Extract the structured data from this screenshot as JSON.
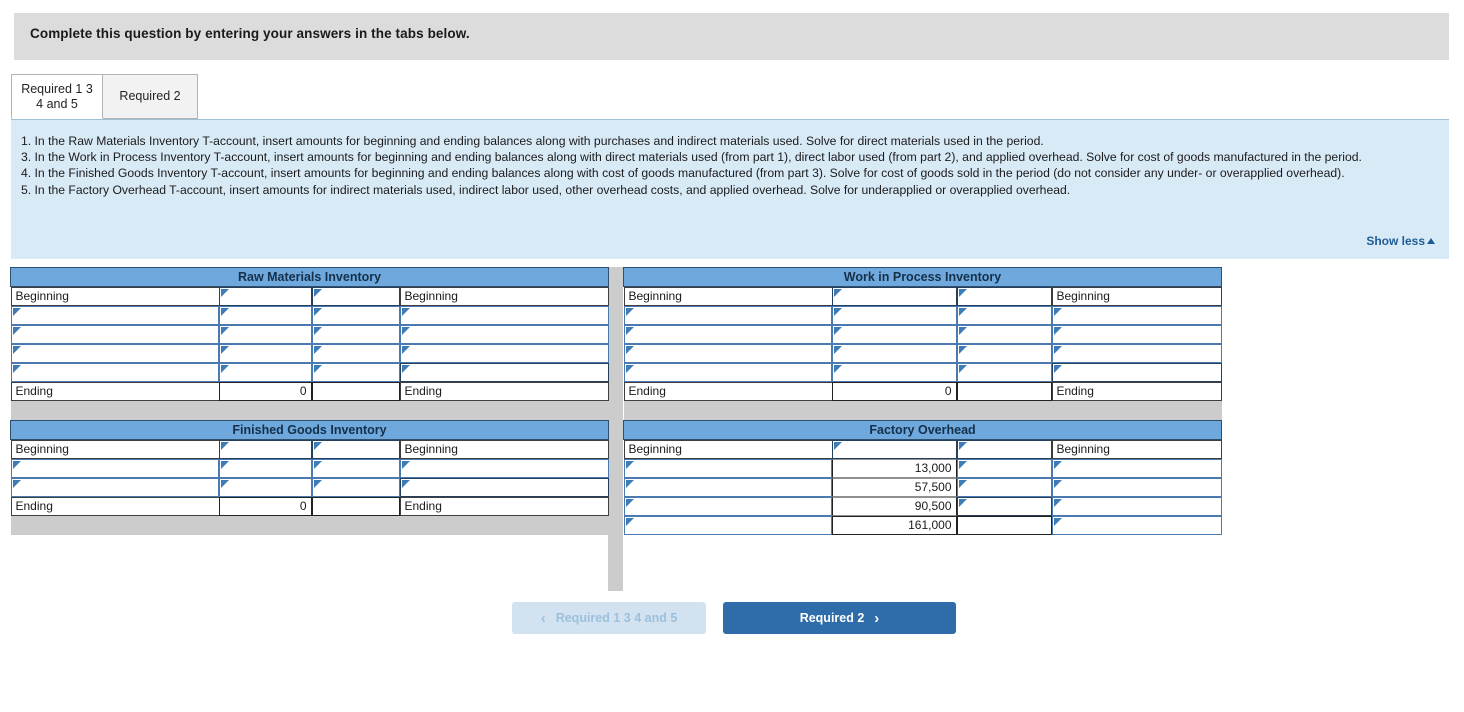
{
  "banner": {
    "text": "Complete this question by entering your answers in the tabs below."
  },
  "tabs": [
    {
      "label": "Required 1 3 4 and 5",
      "active": true
    },
    {
      "label": "Required 2",
      "active": false
    }
  ],
  "instructions": {
    "lines": [
      "1. In the Raw Materials Inventory T-account, insert amounts for beginning and ending balances along with purchases and indirect materials used. Solve for direct materials used in the period.",
      "3. In the Work in Process Inventory T-account, insert amounts for beginning and ending balances along with direct materials used (from part 1), direct labor used (from part 2), and applied overhead. Solve for cost of goods manufactured in the period.",
      "4. In the Finished Goods Inventory T-account, insert amounts for beginning and ending balances along with cost of goods manufactured (from part 3). Solve for cost of goods sold in the period (do not consider any under- or overapplied overhead).",
      "5. In the Factory Overhead T-account, insert amounts for indirect materials used, indirect labor used, other overhead costs, and applied overhead. Solve for underapplied or overapplied overhead."
    ],
    "show_less_label": "Show less"
  },
  "accounts": {
    "raw_materials": {
      "title": "Raw Materials Inventory",
      "rows": [
        {
          "left_label": "Beginning",
          "debit": "",
          "credit": "",
          "right_label": "Beginning"
        },
        {
          "left_label": "",
          "debit": "",
          "credit": "",
          "right_label": ""
        },
        {
          "left_label": "",
          "debit": "",
          "credit": "",
          "right_label": ""
        },
        {
          "left_label": "",
          "debit": "",
          "credit": "",
          "right_label": ""
        },
        {
          "left_label": "",
          "debit": "",
          "credit": "",
          "right_label": ""
        },
        {
          "left_label": "Ending",
          "debit": "0",
          "credit": "",
          "right_label": "Ending"
        }
      ]
    },
    "work_in_process": {
      "title": "Work in Process Inventory",
      "rows": [
        {
          "left_label": "Beginning",
          "debit": "",
          "credit": "",
          "right_label": "Beginning"
        },
        {
          "left_label": "",
          "debit": "",
          "credit": "",
          "right_label": ""
        },
        {
          "left_label": "",
          "debit": "",
          "credit": "",
          "right_label": ""
        },
        {
          "left_label": "",
          "debit": "",
          "credit": "",
          "right_label": ""
        },
        {
          "left_label": "",
          "debit": "",
          "credit": "",
          "right_label": ""
        },
        {
          "left_label": "Ending",
          "debit": "0",
          "credit": "",
          "right_label": "Ending"
        }
      ]
    },
    "finished_goods": {
      "title": "Finished Goods Inventory",
      "rows": [
        {
          "left_label": "Beginning",
          "debit": "",
          "credit": "",
          "right_label": "Beginning"
        },
        {
          "left_label": "",
          "debit": "",
          "credit": "",
          "right_label": ""
        },
        {
          "left_label": "",
          "debit": "",
          "credit": "",
          "right_label": ""
        },
        {
          "left_label": "Ending",
          "debit": "0",
          "credit": "",
          "right_label": "Ending"
        }
      ]
    },
    "factory_overhead": {
      "title": "Factory Overhead",
      "rows": [
        {
          "left_label": "Beginning",
          "debit": "",
          "credit": "",
          "right_label": "Beginning"
        },
        {
          "left_label": "",
          "debit": "13,000",
          "credit": "",
          "right_label": ""
        },
        {
          "left_label": "",
          "debit": "57,500",
          "credit": "",
          "right_label": ""
        },
        {
          "left_label": "",
          "debit": "90,500",
          "credit": "",
          "right_label": ""
        },
        {
          "left_label": "",
          "debit": "161,000",
          "credit": "",
          "right_label": ""
        }
      ]
    }
  },
  "navigation": {
    "prev_label": "Required 1 3 4 and 5",
    "prev_chevron": "‹",
    "next_label": "Required 2",
    "next_chevron": "›"
  },
  "colors": {
    "header_blue": "#6fa8dc",
    "panel_blue": "#d9eaf7",
    "banner_gray": "#dcdcdc",
    "button_blue": "#2e6da9",
    "button_disabled": "#d3e2f0",
    "link_blue": "#1f5c96"
  }
}
